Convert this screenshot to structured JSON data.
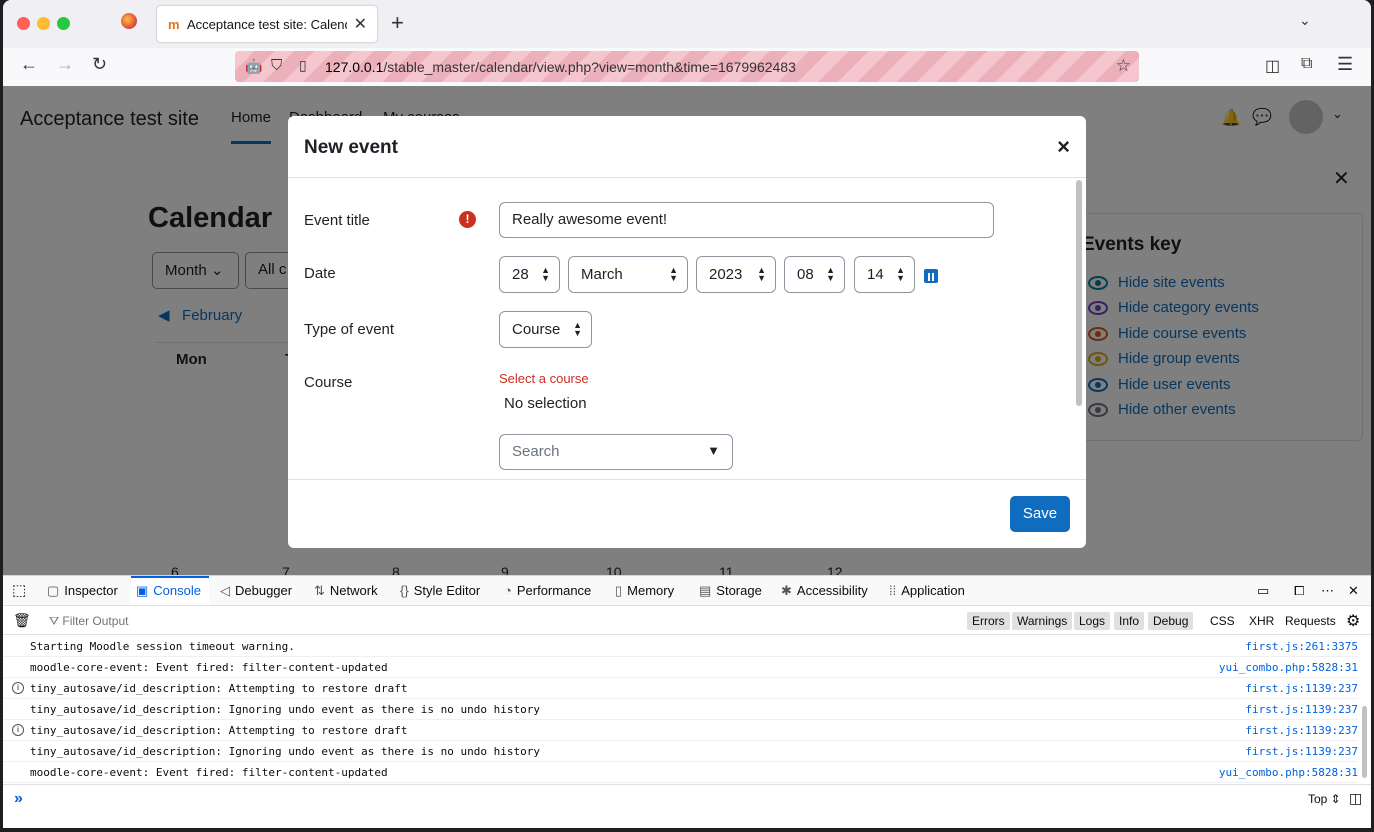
{
  "browser": {
    "tab_title": "Acceptance test site: Calendar: ",
    "url_host": "127.0.0.1",
    "url_path": "/stable_master/calendar/view.php?view=month&time=1679962483",
    "new_tab": "+",
    "tab_close": "✕"
  },
  "page": {
    "site_name": "Acceptance test site",
    "nav": [
      "Home",
      "Dashboard",
      "My courses"
    ],
    "calendar_title": "Calendar",
    "view_select": "Month",
    "course_select": "All c",
    "prev_month": "February",
    "day_headers": [
      "Mon",
      "T"
    ],
    "week_days": [
      "6",
      "7",
      "8",
      "9",
      "10",
      "11",
      "12"
    ],
    "events_key": {
      "title": "Events key",
      "items": [
        {
          "label": "Hide site events",
          "color": "#008196"
        },
        {
          "label": "Hide category events",
          "color": "#6f42c1"
        },
        {
          "label": "Hide course events",
          "color": "#d75b18"
        },
        {
          "label": "Hide group events",
          "color": "#e0a81d"
        },
        {
          "label": "Hide user events",
          "color": "#0f6cbf"
        },
        {
          "label": "Hide other events",
          "color": "#6c757d"
        }
      ]
    }
  },
  "modal": {
    "title": "New event",
    "close": "×",
    "fields": {
      "event_title_label": "Event title",
      "event_title_value": "Really awesome event!",
      "date_label": "Date",
      "date_day": "28",
      "date_month": "March",
      "date_year": "2023",
      "date_hour": "08",
      "date_minute": "14",
      "type_label": "Type of event",
      "type_value": "Course",
      "course_label": "Course",
      "course_error": "Select a course",
      "course_selection": "No selection",
      "search_placeholder": "Search"
    },
    "save": "Save"
  },
  "devtools": {
    "tabs": [
      "Inspector",
      "Console",
      "Debugger",
      "Network",
      "Style Editor",
      "Performance",
      "Memory",
      "Storage",
      "Accessibility",
      "Application"
    ],
    "active_tab": "Console",
    "filter_placeholder": "Filter Output",
    "levels": [
      "Errors",
      "Warnings",
      "Logs",
      "Info",
      "Debug"
    ],
    "types": [
      "CSS",
      "XHR",
      "Requests"
    ],
    "log": [
      {
        "msg": "Starting Moodle session timeout warning.",
        "src": "first.js:261:3375",
        "info": false
      },
      {
        "msg": "moodle-core-event: Event fired: filter-content-updated",
        "src": "yui_combo.php:5828:31",
        "info": false
      },
      {
        "msg": "tiny_autosave/id_description: Attempting to restore draft",
        "src": "first.js:1139:237",
        "info": true
      },
      {
        "msg": "tiny_autosave/id_description: Ignoring undo event as there is no undo history",
        "src": "first.js:1139:237",
        "info": false
      },
      {
        "msg": "tiny_autosave/id_description: Attempting to restore draft",
        "src": "first.js:1139:237",
        "info": true
      },
      {
        "msg": "tiny_autosave/id_description: Ignoring undo event as there is no undo history",
        "src": "first.js:1139:237",
        "info": false
      },
      {
        "msg": "moodle-core-event: Event fired: filter-content-updated",
        "src": "yui_combo.php:5828:31",
        "info": false
      }
    ],
    "prompt": "»",
    "context": "Top ⇕"
  }
}
